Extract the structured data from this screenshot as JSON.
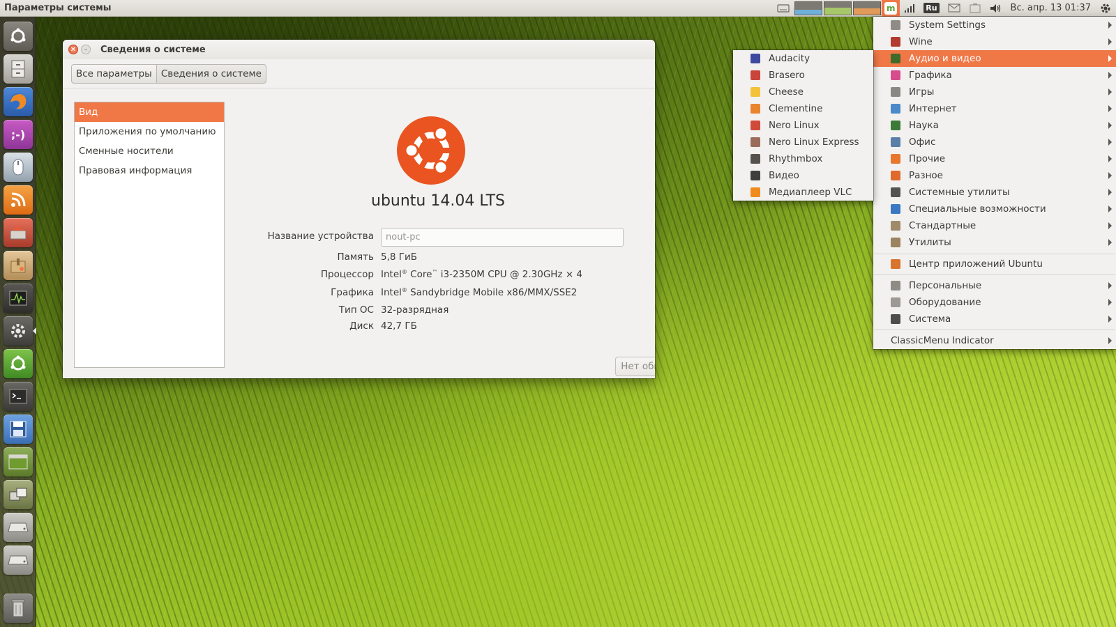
{
  "panel": {
    "title": "Параметры системы",
    "language": "Ru",
    "clock": "Вс. апр. 13 01:37",
    "icons": [
      "keyboard-icon",
      "cpu-monitor",
      "memory-monitor",
      "network-monitor",
      "classicmenu-icon",
      "signal-icon",
      "language-icon",
      "mail-icon",
      "battery-icon",
      "volume-icon",
      "gear-icon"
    ]
  },
  "launcher": {
    "items": [
      {
        "name": "dash-home",
        "icon": "ubuntu-icon"
      },
      {
        "name": "files",
        "icon": "file-cabinet-icon"
      },
      {
        "name": "firefox",
        "icon": "firefox-icon"
      },
      {
        "name": "empathy",
        "icon": "smiley-icon"
      },
      {
        "name": "mouse-settings",
        "icon": "mouse-icon"
      },
      {
        "name": "rss-reader",
        "icon": "rss-icon"
      },
      {
        "name": "nero-linux",
        "icon": "nero-icon"
      },
      {
        "name": "archive-manager",
        "icon": "package-icon"
      },
      {
        "name": "system-monitor",
        "icon": "monitor-icon"
      },
      {
        "name": "system-settings",
        "icon": "settings-icon"
      },
      {
        "name": "software-updater",
        "icon": "ubuntu-green-icon"
      },
      {
        "name": "terminal",
        "icon": "terminal-icon"
      },
      {
        "name": "save-tool",
        "icon": "floppy-icon"
      },
      {
        "name": "workspace-switcher",
        "icon": "workspace-icon"
      },
      {
        "name": "window-manager",
        "icon": "windows-icon"
      },
      {
        "name": "drive-1",
        "icon": "drive-icon"
      },
      {
        "name": "drive-2",
        "icon": "drive-icon"
      },
      {
        "name": "trash",
        "icon": "trash-icon"
      }
    ]
  },
  "window": {
    "title": "Сведения о системе",
    "breadcrumbs": [
      "Все параметры",
      "Сведения о системе"
    ],
    "sidebar": [
      "Вид",
      "Приложения по умолчанию",
      "Сменные носители",
      "Правовая информация"
    ],
    "os_name": "ubuntu 14.04 LTS",
    "device": {
      "label": "Название устройства",
      "placeholder": "nout-pc"
    },
    "rows": [
      {
        "label": "Память",
        "value": "5,8 ГиБ"
      },
      {
        "label": "Процессор",
        "value_parts": [
          "Intel",
          "®",
          " Core",
          "™",
          " i3-2350M CPU @ 2.30GHz × 4"
        ]
      },
      {
        "label": "Графика",
        "value_parts": [
          "Intel",
          "®",
          " Sandybridge Mobile x86/MMX/SSE2"
        ]
      },
      {
        "label": "Тип ОС",
        "value": "32-разрядная"
      },
      {
        "label": "Диск",
        "value": "42,7 ГБ"
      }
    ],
    "updates_button": "Нет обновлений"
  },
  "menu": {
    "items": [
      {
        "label": "System Settings",
        "icon": "settings-icon",
        "color": "#8f8c86"
      },
      {
        "label": "Wine",
        "icon": "wine-icon",
        "color": "#b23b2f"
      },
      {
        "label": "Аудио и видео",
        "icon": "multimedia-icon",
        "color": "#3f6b2a"
      },
      {
        "label": "Графика",
        "icon": "graphics-icon",
        "color": "#d64c8c"
      },
      {
        "label": "Игры",
        "icon": "games-icon",
        "color": "#8a8883"
      },
      {
        "label": "Интернет",
        "icon": "internet-icon",
        "color": "#4a8ac9"
      },
      {
        "label": "Наука",
        "icon": "science-icon",
        "color": "#3c7a3a"
      },
      {
        "label": "Офис",
        "icon": "office-icon",
        "color": "#5a7fa8"
      },
      {
        "label": "Прочие",
        "icon": "other-icon",
        "color": "#e8772e"
      },
      {
        "label": "Разное",
        "icon": "misc-icon",
        "color": "#e06a2c"
      },
      {
        "label": "Системные утилиты",
        "icon": "system-tools-icon",
        "color": "#55534f"
      },
      {
        "label": "Специальные возможности",
        "icon": "accessibility-icon",
        "color": "#3a78c3"
      },
      {
        "label": "Стандартные",
        "icon": "accessories-icon",
        "color": "#a08a6a"
      },
      {
        "label": "Утилиты",
        "icon": "utilities-icon",
        "color": "#9b8560"
      },
      {
        "label": "Центр приложений Ubuntu",
        "icon": "software-center-icon",
        "color": "#d8742e"
      },
      {
        "label": "Персональные",
        "icon": "personal-icon",
        "color": "#8e8b85"
      },
      {
        "label": "Оборудование",
        "icon": "hardware-icon",
        "color": "#9c9994"
      },
      {
        "label": "Система",
        "icon": "system-icon",
        "color": "#4f4d49"
      },
      {
        "label": "ClassicMenu Indicator"
      }
    ]
  },
  "submenu": {
    "items": [
      {
        "label": "Audacity",
        "icon": "audacity-icon",
        "color": "#3d4a9e"
      },
      {
        "label": "Brasero",
        "icon": "brasero-icon",
        "color": "#c9443a"
      },
      {
        "label": "Cheese",
        "icon": "cheese-icon",
        "color": "#f2c33a"
      },
      {
        "label": "Clementine",
        "icon": "clementine-icon",
        "color": "#e8832e"
      },
      {
        "label": "Nero Linux",
        "icon": "nero-icon",
        "color": "#d04a3a"
      },
      {
        "label": "Nero Linux Express",
        "icon": "nero-express-icon",
        "color": "#9a6c5a"
      },
      {
        "label": "Rhythmbox",
        "icon": "rhythmbox-icon",
        "color": "#55524d"
      },
      {
        "label": "Видео",
        "icon": "video-icon",
        "color": "#3f3e3a"
      },
      {
        "label": "Медиаплеер VLC",
        "icon": "vlc-icon",
        "color": "#ef8a1f"
      }
    ]
  },
  "colors": {
    "accent": "#f07746",
    "window_bg": "#f2f1f0",
    "panel_bg": "#dfdcd6"
  }
}
